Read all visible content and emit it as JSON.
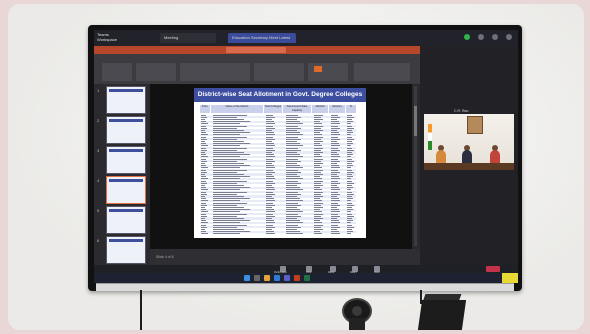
{
  "scene": {
    "teams": {
      "logo_line1": "Teams",
      "logo_line2": "Workspace",
      "tab1_label": "Meeting",
      "tab2_label": "Education Secretary Meet Latest"
    },
    "slide": {
      "title": "District-wise Seat Allotment in Govt. Degree Colleges",
      "columns": [
        "S.No.",
        "Name of the District",
        "Total Colleges",
        "Sanctioned Intake Capacity",
        "Allotted",
        "Vacancy",
        "%"
      ],
      "row_count": 55
    },
    "thumbnail_numbers": [
      "1",
      "2",
      "3",
      "4",
      "5",
      "6"
    ],
    "video": {
      "label": "C.R. Rao"
    },
    "controls": [
      "Participants",
      "Chat",
      "Raise",
      "React",
      "View"
    ],
    "status_text": "Slide 4 of 6",
    "colors": {
      "ppt_accent": "#b7472a",
      "slide_header": "#3d4ea0",
      "teams_tab_active": "#3a4b9a",
      "leave_button": "#c4314b"
    }
  }
}
